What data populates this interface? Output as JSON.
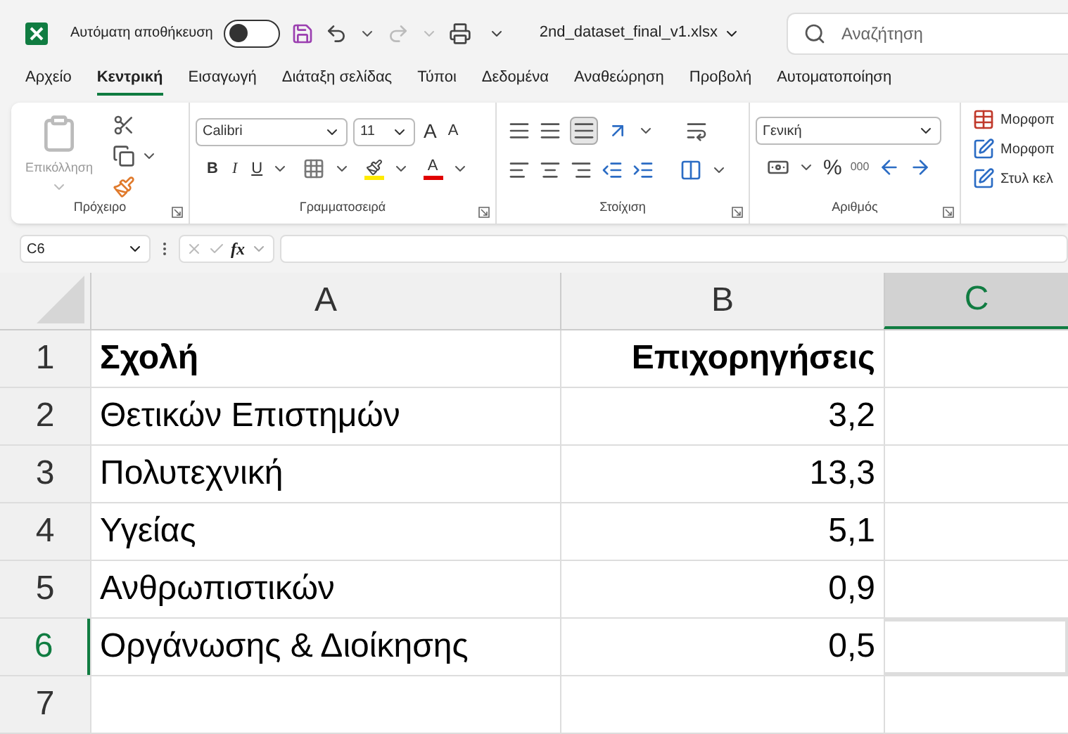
{
  "title_bar": {
    "autosave_label": "Αυτόματη αποθήκευση",
    "autosave_on": false,
    "filename": "2nd_dataset_final_v1.xlsx",
    "search_placeholder": "Αναζήτηση"
  },
  "menu_tabs": [
    {
      "label": "Αρχείο",
      "selected": false
    },
    {
      "label": "Κεντρική",
      "selected": true
    },
    {
      "label": "Εισαγωγή",
      "selected": false
    },
    {
      "label": "Διάταξη σελίδας",
      "selected": false
    },
    {
      "label": "Τύποι",
      "selected": false
    },
    {
      "label": "Δεδομένα",
      "selected": false
    },
    {
      "label": "Αναθεώρηση",
      "selected": false
    },
    {
      "label": "Προβολή",
      "selected": false
    },
    {
      "label": "Αυτοματοποίηση",
      "selected": false
    }
  ],
  "ribbon": {
    "clipboard": {
      "paste_label": "Επικόλληση",
      "group_label": "Πρόχειρο"
    },
    "font": {
      "font_name": "Calibri",
      "font_size": "11",
      "grow": "A",
      "shrink": "A",
      "bold": "B",
      "italic": "I",
      "underline": "U",
      "font_color": "A",
      "group_label": "Γραμματοσειρά"
    },
    "alignment": {
      "group_label": "Στοίχιση"
    },
    "number": {
      "format": "Γενική",
      "percent": "%",
      "thousands": "000",
      "group_label": "Αριθμός"
    },
    "styles": [
      "Μορφοπ",
      "Μορφοπ",
      "Στυλ κελ"
    ]
  },
  "formula_bar": {
    "name_box": "C6",
    "fx": "fx"
  },
  "sheet": {
    "columns": [
      {
        "label": "A",
        "selected": false
      },
      {
        "label": "B",
        "selected": false
      },
      {
        "label": "C",
        "selected": true
      }
    ],
    "rows": [
      {
        "number": "1",
        "selected": false,
        "header": true,
        "cells": [
          "Σχολή",
          "Επιχορηγήσεις"
        ]
      },
      {
        "number": "2",
        "selected": false,
        "header": false,
        "cells": [
          "Θετικών Επιστημών",
          "3,2"
        ]
      },
      {
        "number": "3",
        "selected": false,
        "header": false,
        "cells": [
          "Πολυτεχνική",
          "13,3"
        ]
      },
      {
        "number": "4",
        "selected": false,
        "header": false,
        "cells": [
          "Υγείας",
          "5,1"
        ]
      },
      {
        "number": "5",
        "selected": false,
        "header": false,
        "cells": [
          "Ανθρωπιστικών",
          "0,9"
        ]
      },
      {
        "number": "6",
        "selected": true,
        "header": false,
        "cells": [
          "Οργάνωσης & Διοίκησης",
          "0,5"
        ]
      },
      {
        "number": "7",
        "selected": false
      }
    ]
  }
}
